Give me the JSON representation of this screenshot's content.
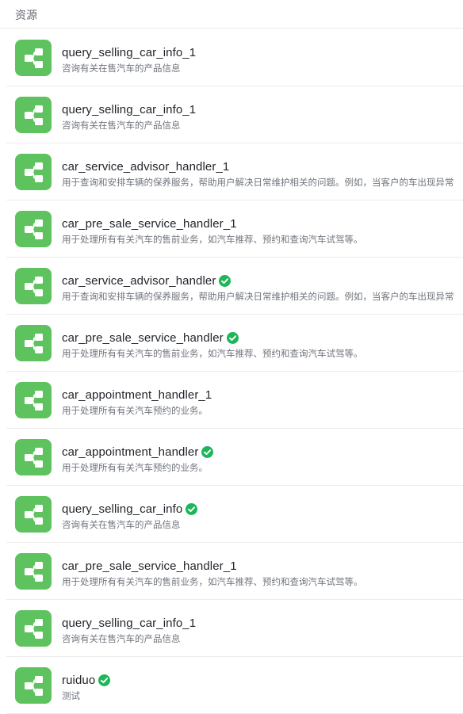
{
  "section": {
    "title": "资源"
  },
  "colors": {
    "icon_bg": "#5ec35f",
    "verified": "#1fb65a"
  },
  "items": [
    {
      "name": "query_selling_car_info_1",
      "desc": "咨询有关在售汽车的产品信息",
      "verified": false,
      "icon": "workflow-icon"
    },
    {
      "name": "query_selling_car_info_1",
      "desc": "咨询有关在售汽车的产品信息",
      "verified": false,
      "icon": "workflow-icon"
    },
    {
      "name": "car_service_advisor_handler_1",
      "desc": "用于查询和安排车辆的保养服务，帮助用户解决日常维护相关的问题。例如，当客户的车出现异常",
      "verified": false,
      "icon": "workflow-icon"
    },
    {
      "name": "car_pre_sale_service_handler_1",
      "desc": "用于处理所有有关汽车的售前业务，如汽车推荐、预约和查询汽车试驾等。",
      "verified": false,
      "icon": "workflow-icon"
    },
    {
      "name": "car_service_advisor_handler",
      "desc": "用于查询和安排车辆的保养服务，帮助用户解决日常维护相关的问题。例如，当客户的车出现异常",
      "verified": true,
      "icon": "workflow-icon"
    },
    {
      "name": "car_pre_sale_service_handler",
      "desc": "用于处理所有有关汽车的售前业务，如汽车推荐、预约和查询汽车试驾等。",
      "verified": true,
      "icon": "workflow-icon"
    },
    {
      "name": "car_appointment_handler_1",
      "desc": "用于处理所有有关汽车预约的业务。",
      "verified": false,
      "icon": "workflow-icon"
    },
    {
      "name": "car_appointment_handler",
      "desc": "用于处理所有有关汽车预约的业务。",
      "verified": true,
      "icon": "workflow-icon"
    },
    {
      "name": "query_selling_car_info",
      "desc": "咨询有关在售汽车的产品信息",
      "verified": true,
      "icon": "workflow-icon"
    },
    {
      "name": "car_pre_sale_service_handler_1",
      "desc": "用于处理所有有关汽车的售前业务，如汽车推荐、预约和查询汽车试驾等。",
      "verified": false,
      "icon": "workflow-icon"
    },
    {
      "name": "query_selling_car_info_1",
      "desc": "咨询有关在售汽车的产品信息",
      "verified": false,
      "icon": "workflow-icon"
    },
    {
      "name": "ruiduo",
      "desc": "测试",
      "verified": true,
      "icon": "workflow-icon"
    }
  ]
}
